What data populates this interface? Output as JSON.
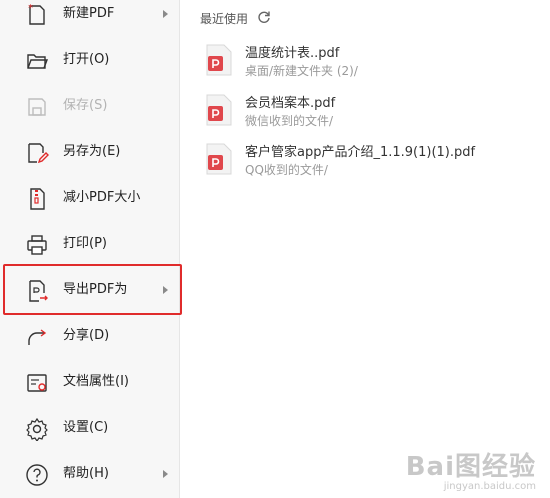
{
  "menu": {
    "items": [
      {
        "label": "新建PDF",
        "icon": "new-pdf-icon",
        "submenu": true,
        "enabled": true
      },
      {
        "label": "打开(O)",
        "icon": "folder-open-icon",
        "submenu": false,
        "enabled": true
      },
      {
        "label": "保存(S)",
        "icon": "save-icon",
        "submenu": false,
        "enabled": false
      },
      {
        "label": "另存为(E)",
        "icon": "save-as-icon",
        "submenu": false,
        "enabled": true
      },
      {
        "label": "减小PDF大小",
        "icon": "compress-pdf-icon",
        "submenu": false,
        "enabled": true
      },
      {
        "label": "打印(P)",
        "icon": "printer-icon",
        "submenu": false,
        "enabled": true
      },
      {
        "label": "导出PDF为",
        "icon": "export-pdf-icon",
        "submenu": true,
        "enabled": true
      },
      {
        "label": "分享(D)",
        "icon": "share-icon",
        "submenu": false,
        "enabled": true
      },
      {
        "label": "文档属性(I)",
        "icon": "doc-properties-icon",
        "submenu": false,
        "enabled": true
      },
      {
        "label": "设置(C)",
        "icon": "gear-icon",
        "submenu": false,
        "enabled": true
      },
      {
        "label": "帮助(H)",
        "icon": "help-icon",
        "submenu": true,
        "enabled": true
      }
    ],
    "highlighted": "导出PDF为"
  },
  "recent": {
    "title": "最近使用",
    "files": [
      {
        "name": "温度统计表..pdf",
        "path": "桌面/新建文件夹 (2)/"
      },
      {
        "name": "会员档案本.pdf",
        "path": "微信收到的文件/"
      },
      {
        "name": "客户管家app产品介绍_1.1.9(1)(1).pdf",
        "path": "QQ收到的文件/"
      }
    ]
  },
  "colors": {
    "accent_red": "#e02b2b",
    "pdf_red": "#e0474c",
    "menu_bg": "#f7f7f7"
  },
  "watermark": {
    "main": "Bai图经验",
    "sub": "jingyan.baidu.com"
  }
}
